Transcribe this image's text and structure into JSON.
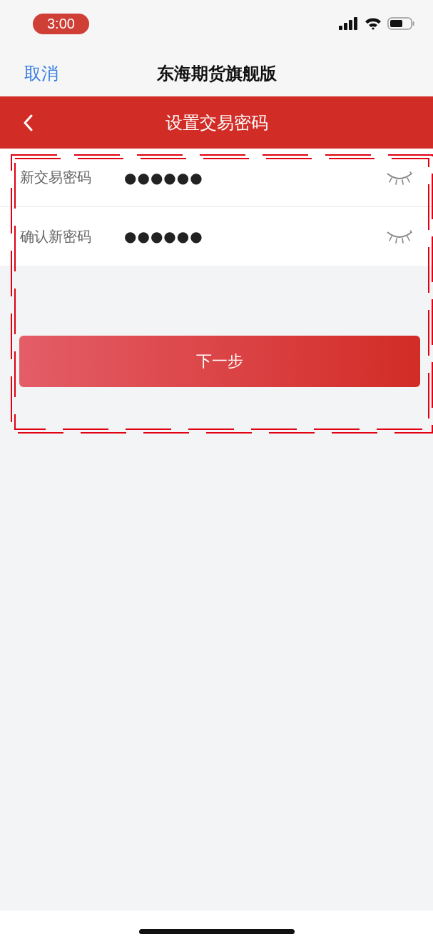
{
  "status_bar": {
    "time": "3:00"
  },
  "nav_bar": {
    "cancel": "取消",
    "title": "东海期货旗舰版"
  },
  "header": {
    "title": "设置交易密码"
  },
  "fields": [
    {
      "label": "新交易密码",
      "value": "●●●●●●"
    },
    {
      "label": "确认新密码",
      "value": "●●●●●●"
    }
  ],
  "next_button": "下一步"
}
